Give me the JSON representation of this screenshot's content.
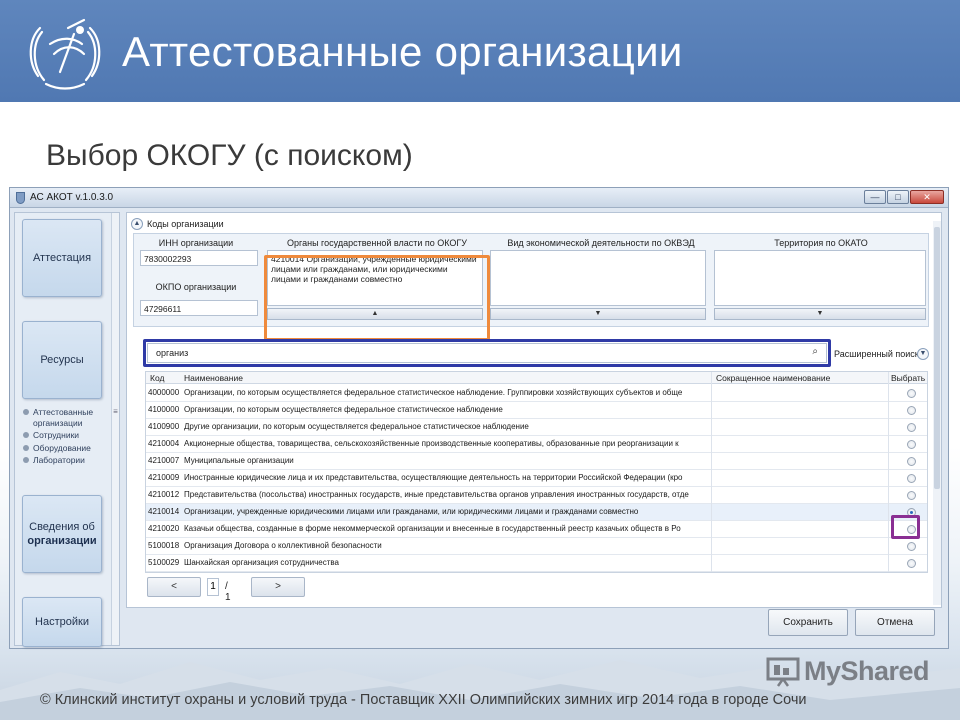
{
  "slide": {
    "title": "Аттестованные организации",
    "subtitle": "Выбор ОКОГУ (с поиском)",
    "footer": "© Клинский институт охраны и условий труда - Поставщик XXII Олимпийских зимних игр 2014 года в городе Сочи",
    "watermark": "MyShared",
    "header_color": "#5578b2"
  },
  "window": {
    "title": "АС АКОТ v.1.0.3.0",
    "controls": [
      "—",
      "□",
      "✕"
    ]
  },
  "nav": {
    "tiles": [
      "Аттестация",
      "Ресурсы",
      "Настройки"
    ],
    "info_tile": {
      "line1": "Сведения об",
      "line2": "организации"
    },
    "submenu": [
      "Аттестованные организации",
      "Сотрудники",
      "Оборудование",
      "Лаборатории"
    ]
  },
  "section": {
    "title": "Коды организации"
  },
  "filters": {
    "inn_label": "ИНН организации",
    "inn_value": "7830002293",
    "okpo_label": "ОКПО организации",
    "okpo_value": "47296611",
    "okogu_label": "Органы государственной власти по ОКОГУ",
    "okogu_value": "4210014 Организации, учрежденные юридическими лицами или гражданами, или юридическими лицами и гражданами совместно",
    "okved_label": "Вид экономической деятельности по ОКВЭД",
    "okved_value": "",
    "okato_label": "Территория по ОКАТО",
    "okato_value": ""
  },
  "search": {
    "value": "организ",
    "advanced_label": "Расширенный поиск"
  },
  "table": {
    "headers": [
      "Код",
      "Наименование",
      "Сокращенное наименование",
      "Выбрать"
    ],
    "rows": [
      {
        "code": "4000000",
        "name": "Организации, по которым осуществляется федеральное статистическое наблюдение. Группировки хозяйствующих субъектов и обще",
        "short": "",
        "selected": false
      },
      {
        "code": "4100000",
        "name": "Организации, по которым осуществляется федеральное статистическое наблюдение",
        "short": "",
        "selected": false
      },
      {
        "code": "4100900",
        "name": "Другие организации, по которым осуществляется федеральное статистическое наблюдение",
        "short": "",
        "selected": false
      },
      {
        "code": "4210004",
        "name": "Акционерные общества, товарищества, сельскохозяйственные производственные кооперативы, образованные при реорганизации к",
        "short": "",
        "selected": false
      },
      {
        "code": "4210007",
        "name": "Муниципальные организации",
        "short": "",
        "selected": false
      },
      {
        "code": "4210009",
        "name": "Иностранные юридические лица и их представительства, осуществляющие деятельность на территории Российской Федерации (кро",
        "short": "",
        "selected": false
      },
      {
        "code": "4210012",
        "name": "Представительства (посольства) иностранных государств, иные представительства органов управления иностранных государств, отде",
        "short": "",
        "selected": false
      },
      {
        "code": "4210014",
        "name": "Организации, учрежденные юридическими лицами или гражданами, или юридическими лицами и гражданами совместно",
        "short": "",
        "selected": true
      },
      {
        "code": "4210020",
        "name": "Казачьи общества, созданные в форме некоммерческой организации и внесенные в государственный реестр казачьих обществ в Ро",
        "short": "",
        "selected": false
      },
      {
        "code": "5100018",
        "name": "Организация Договора о коллективной безопасности",
        "short": "",
        "selected": false
      },
      {
        "code": "5100029",
        "name": "Шанхайская организация сотрудничества",
        "short": "",
        "selected": false
      }
    ]
  },
  "pager": {
    "prev": "<",
    "next": ">",
    "page": "1",
    "of": "/  1"
  },
  "buttons": {
    "save": "Сохранить",
    "cancel": "Отмена"
  }
}
